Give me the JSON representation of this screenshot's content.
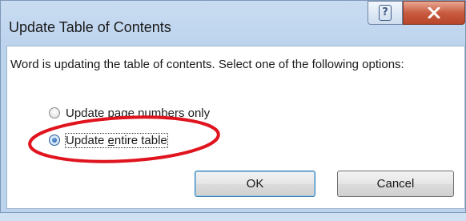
{
  "dialog": {
    "title": "Update Table of Contents",
    "help_glyph": "?",
    "message": "Word is updating the table of contents.  Select one of the following options:",
    "options": [
      {
        "pre": "Update ",
        "accel": "p",
        "post": "age numbers only",
        "selected": false
      },
      {
        "pre": "Update ",
        "accel": "e",
        "post": "ntire table",
        "selected": true
      }
    ],
    "ok_label": "OK",
    "cancel_label": "Cancel"
  },
  "annotation": {
    "shape": "red-ellipse",
    "color": "#e0141e",
    "target": "Update entire table"
  },
  "colors": {
    "close_button": "#c85b3f",
    "titlebar": "#c9dcf1",
    "default_button_border": "#3c7fb1"
  }
}
